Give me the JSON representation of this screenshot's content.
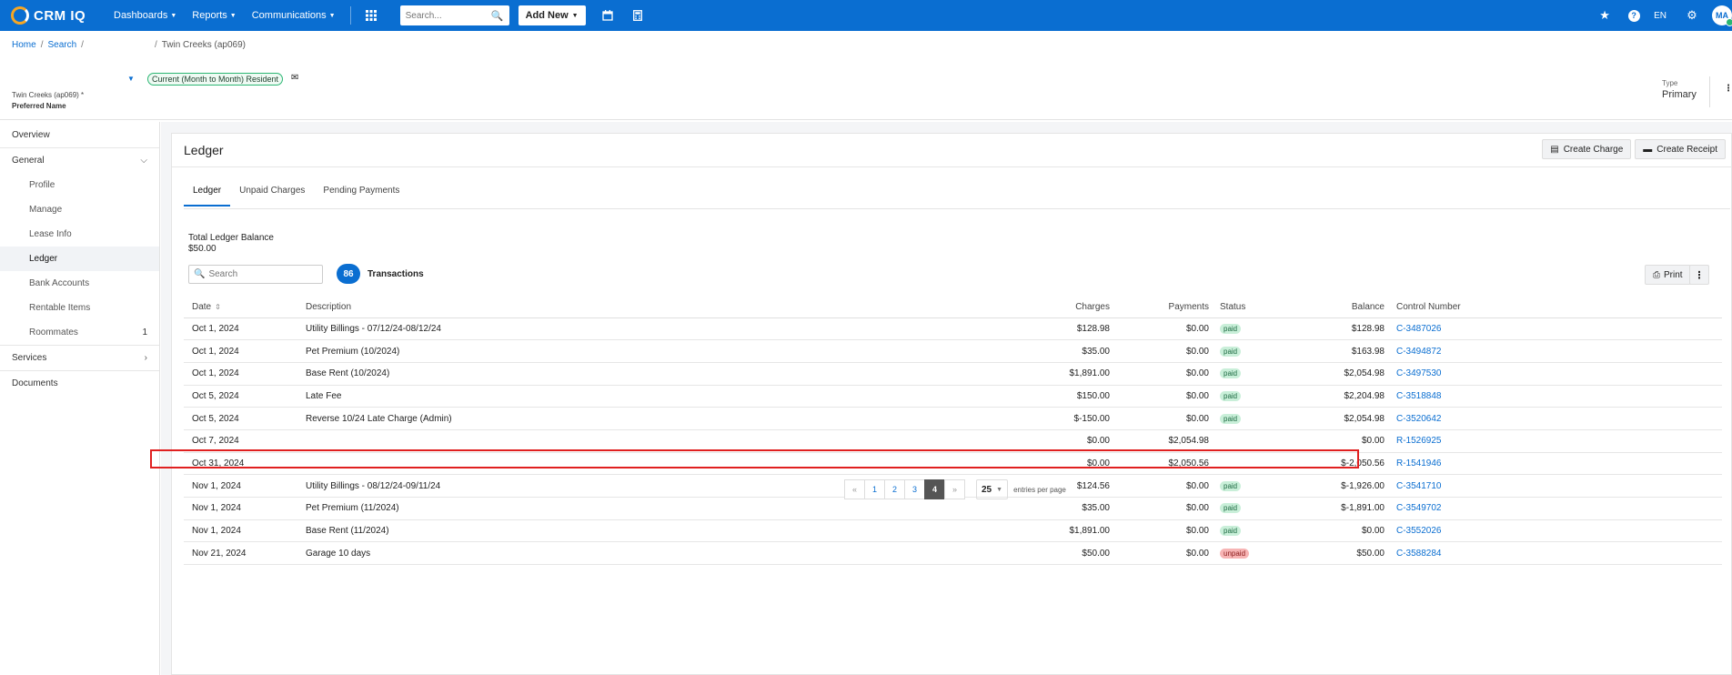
{
  "topbar": {
    "brand": "CRM IQ",
    "nav": [
      "Dashboards",
      "Reports",
      "Communications"
    ],
    "search_placeholder": "Search...",
    "add_new": "Add New",
    "lang": "EN",
    "avatar_initials": "MA"
  },
  "breadcrumb": {
    "home": "Home",
    "search": "Search",
    "current": "Twin Creeks (ap069)"
  },
  "resident": {
    "status_badge": "Current (Month to Month) Resident",
    "property": "Twin Creeks (ap069)",
    "required_mark": "*",
    "preferred_name_label": "Preferred Name",
    "type_label": "Type",
    "type_value": "Primary"
  },
  "sidebar": {
    "overview": "Overview",
    "general": "General",
    "items": [
      "Profile",
      "Manage",
      "Lease Info",
      "Ledger",
      "Bank Accounts",
      "Rentable Items",
      "Roommates"
    ],
    "roommates_count": "1",
    "services": "Services",
    "documents": "Documents"
  },
  "card": {
    "title": "Ledger",
    "create_charge": "Create Charge",
    "create_receipt": "Create Receipt",
    "tabs": [
      "Ledger",
      "Unpaid Charges",
      "Pending Payments"
    ],
    "balance_label": "Total Ledger Balance",
    "balance_value": "$50.00",
    "search_placeholder": "Search",
    "tx_count": "86",
    "tx_label": "Transactions",
    "print": "Print"
  },
  "table": {
    "headers": [
      "Date",
      "Description",
      "Charges",
      "Payments",
      "Status",
      "Balance",
      "Control Number"
    ],
    "rows": [
      {
        "date": "Oct 1, 2024",
        "desc": "Utility Billings - 07/12/24-08/12/24",
        "charges": "$128.98",
        "payments": "$0.00",
        "status": "paid",
        "balance": "$128.98",
        "ctrl": "C-3487026"
      },
      {
        "date": "Oct 1, 2024",
        "desc": "Pet Premium (10/2024)",
        "charges": "$35.00",
        "payments": "$0.00",
        "status": "paid",
        "balance": "$163.98",
        "ctrl": "C-3494872"
      },
      {
        "date": "Oct 1, 2024",
        "desc": "Base Rent (10/2024)",
        "charges": "$1,891.00",
        "payments": "$0.00",
        "status": "paid",
        "balance": "$2,054.98",
        "ctrl": "C-3497530"
      },
      {
        "date": "Oct 5, 2024",
        "desc": "Late Fee",
        "charges": "$150.00",
        "payments": "$0.00",
        "status": "paid",
        "balance": "$2,204.98",
        "ctrl": "C-3518848"
      },
      {
        "date": "Oct 5, 2024",
        "desc": "Reverse 10/24 Late Charge (Admin)",
        "charges": "$-150.00",
        "payments": "$0.00",
        "status": "paid",
        "balance": "$2,054.98",
        "ctrl": "C-3520642"
      },
      {
        "date": "Oct 7, 2024",
        "desc": "",
        "charges": "$0.00",
        "payments": "$2,054.98",
        "status": "",
        "balance": "$0.00",
        "ctrl": "R-1526925"
      },
      {
        "date": "Oct 31, 2024",
        "desc": "",
        "charges": "$0.00",
        "payments": "$2,050.56",
        "status": "",
        "balance": "$-2,050.56",
        "ctrl": "R-1541946"
      },
      {
        "date": "Nov 1, 2024",
        "desc": "Utility Billings - 08/12/24-09/11/24",
        "charges": "$124.56",
        "payments": "$0.00",
        "status": "paid",
        "balance": "$-1,926.00",
        "ctrl": "C-3541710"
      },
      {
        "date": "Nov 1, 2024",
        "desc": "Pet Premium (11/2024)",
        "charges": "$35.00",
        "payments": "$0.00",
        "status": "paid",
        "balance": "$-1,891.00",
        "ctrl": "C-3549702"
      },
      {
        "date": "Nov 1, 2024",
        "desc": "Base Rent (11/2024)",
        "charges": "$1,891.00",
        "payments": "$0.00",
        "status": "paid",
        "balance": "$0.00",
        "ctrl": "C-3552026"
      },
      {
        "date": "Nov 21, 2024",
        "desc": "Garage 10 days",
        "charges": "$50.00",
        "payments": "$0.00",
        "status": "unpaid",
        "balance": "$50.00",
        "ctrl": "C-3588284"
      }
    ]
  },
  "pager": {
    "prev": "«",
    "pages": [
      "1",
      "2",
      "3",
      "4"
    ],
    "next": "»",
    "per_page": "25",
    "per_page_label": "entries per page"
  },
  "colors": {
    "brand": "#0a6ed1",
    "paid_bg": "#c9efd9",
    "unpaid_bg": "#f7b4b4",
    "highlight": "#e02020"
  }
}
